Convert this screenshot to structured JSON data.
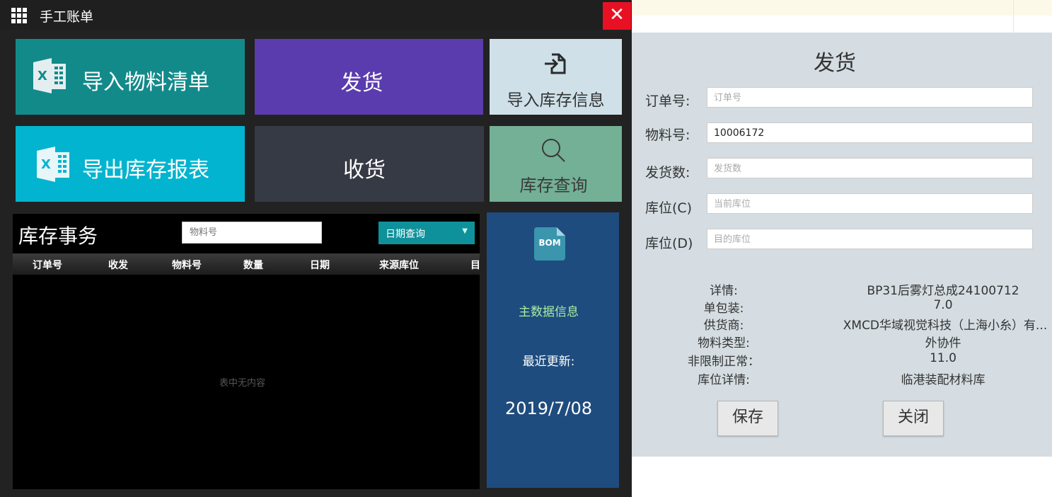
{
  "app": {
    "title": "手工账单",
    "close_glyph": "✕"
  },
  "tiles": {
    "import_materials": "导入物料清单",
    "ship": "发货",
    "import_stock": "导入库存信息",
    "export_report": "导出库存报表",
    "receive": "收货",
    "stock_query": "库存查询"
  },
  "transactions": {
    "title": "库存事务",
    "search_placeholder": "物料号",
    "date_filter": "日期查询",
    "columns": [
      "订单号",
      "收发",
      "物料号",
      "数量",
      "日期",
      "来源库位",
      "目"
    ],
    "empty_text": "表中无内容"
  },
  "master_data": {
    "icon_text": "BOM",
    "label": "主数据信息",
    "update_label": "最近更新:",
    "update_date": "2019/7/08"
  },
  "dialog": {
    "title": "发货",
    "fields": [
      {
        "label": "订单号:",
        "value": "",
        "placeholder": "订单号"
      },
      {
        "label": "物料号:",
        "value": "10006172",
        "placeholder": ""
      },
      {
        "label": "发货数:",
        "value": "",
        "placeholder": "发货数"
      },
      {
        "label": "库位(C)",
        "value": "",
        "placeholder": "当前库位"
      },
      {
        "label": "库位(D)",
        "value": "",
        "placeholder": "目的库位"
      }
    ],
    "details": [
      {
        "label": "详情:",
        "value": "BP31后雾灯总成24100712"
      },
      {
        "label": "单包装:",
        "value": "7.0"
      },
      {
        "label": "供货商:",
        "value": "XMCD华域视觉科技（上海小糸）有..."
      },
      {
        "label": "物料类型:",
        "value": "外协件"
      },
      {
        "label": "非限制正常：",
        "value": "11.0"
      },
      {
        "label": "库位详情:",
        "value": "临港装配材料库"
      }
    ],
    "save_button": "保存",
    "close_button": "关闭"
  }
}
